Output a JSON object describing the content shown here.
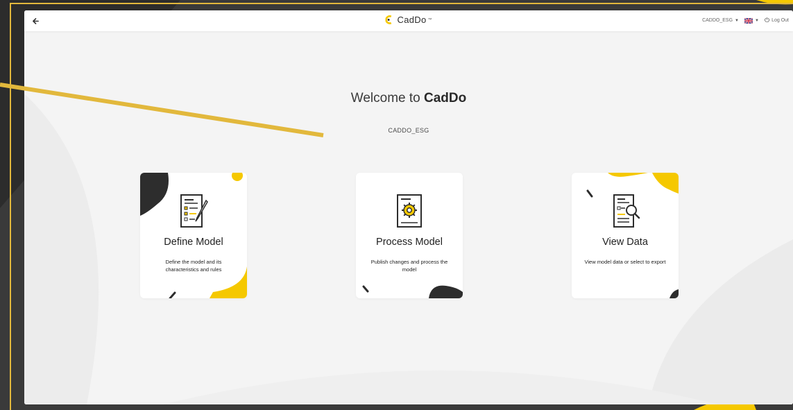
{
  "colors": {
    "accent": "#f5c800",
    "dark": "#2d2d2d",
    "frame": "#e2b83c"
  },
  "topbar": {
    "back_icon": "arrow-left-icon",
    "brand": {
      "name": "CadDo",
      "tm": "™",
      "logo_icon": "caddo-logo-icon"
    },
    "user_menu": "CADDO_ESG",
    "language_icon": "uk-flag-icon",
    "logout_label": "Log Out",
    "logout_icon": "power-icon"
  },
  "main": {
    "welcome_prefix": "Welcome to ",
    "welcome_brand": "CadDo",
    "subtitle": "CADDO_ESG"
  },
  "cards": [
    {
      "title": "Define Model",
      "description": "Define the model and its characteristics and rules",
      "icon": "define-model-icon"
    },
    {
      "title": "Process Model",
      "description": "Publish changes and process the model",
      "icon": "process-model-icon"
    },
    {
      "title": "View Data",
      "description": "View model data or select to export",
      "icon": "view-data-icon"
    }
  ]
}
